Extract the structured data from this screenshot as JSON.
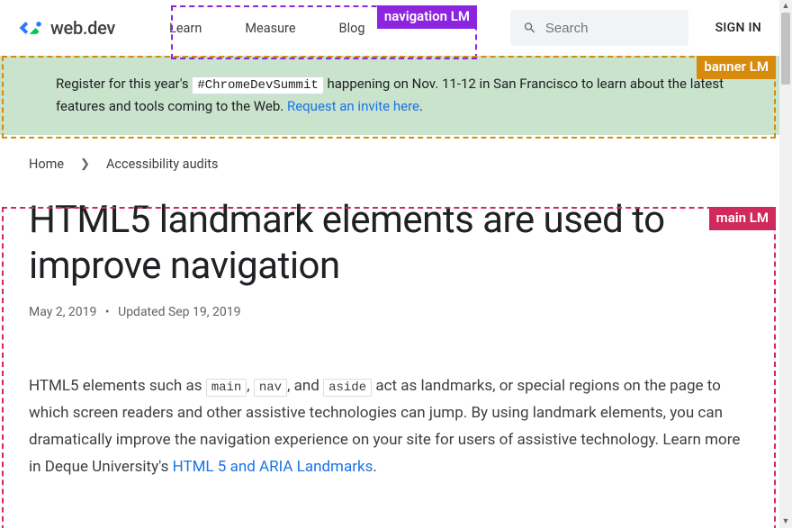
{
  "header": {
    "logo_text": "web.dev",
    "nav": [
      "Learn",
      "Measure",
      "Blog"
    ],
    "search_placeholder": "Search",
    "signin": "SIGN IN"
  },
  "banner": {
    "text_before": "Register for this year's ",
    "hashtag": "#ChromeDevSummit",
    "text_mid": " happening on Nov. 11-12 in San Francisco to learn about the latest features and tools coming to the Web. ",
    "link_text": "Request an invite here",
    "period": "."
  },
  "breadcrumbs": {
    "home": "Home",
    "current": "Accessibility audits"
  },
  "article": {
    "title": "HTML5 landmark elements are used to improve navigation",
    "date_published": "May 2, 2019",
    "updated_label": "Updated ",
    "date_updated": "Sep 19, 2019",
    "body_1": "HTML5 elements such as ",
    "code_1": "main",
    "body_2": ", ",
    "code_2": "nav",
    "body_3": ", and ",
    "code_3": "aside",
    "body_4": " act as landmarks, or special regions on the page to which screen readers and other assistive technologies can jump. By using landmark elements, you can dramatically improve the navigation experience on your site for users of assistive technology. Learn more in Deque University's ",
    "body_link": "HTML 5 and ARIA Landmarks",
    "body_5": "."
  },
  "landmarks": {
    "nav": "navigation LM",
    "banner": "banner LM",
    "main": "main LM"
  }
}
